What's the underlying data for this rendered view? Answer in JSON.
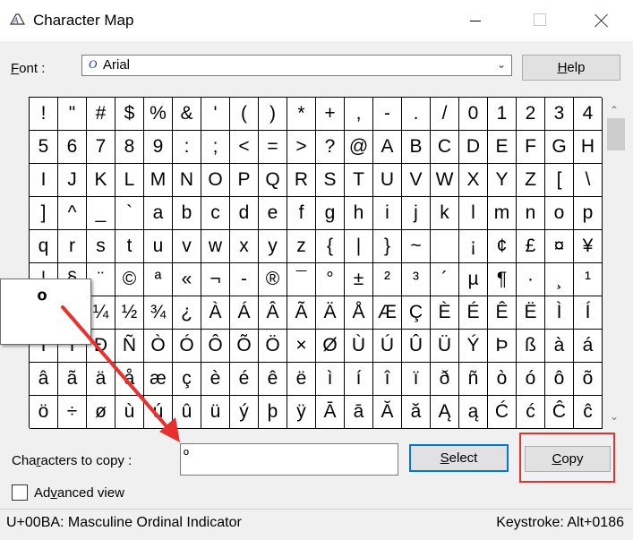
{
  "window": {
    "title": "Character Map",
    "app_icon": "character-map-icon"
  },
  "font": {
    "label_prefix": "F",
    "label_rest": "ont :",
    "selected": "Arial",
    "font_icon": "opentype-font-icon"
  },
  "help_button": {
    "label_underlined": "H",
    "label_rest": "elp"
  },
  "characters": [
    "!",
    "\"",
    "#",
    "$",
    "%",
    "&",
    "'",
    "(",
    ")",
    "*",
    "+",
    ",",
    "-",
    ".",
    "/",
    "0",
    "1",
    "2",
    "3",
    "4",
    "5",
    "6",
    "7",
    "8",
    "9",
    ":",
    ";",
    "<",
    "=",
    ">",
    "?",
    "@",
    "A",
    "B",
    "C",
    "D",
    "E",
    "F",
    "G",
    "H",
    "I",
    "J",
    "K",
    "L",
    "M",
    "N",
    "O",
    "P",
    "Q",
    "R",
    "S",
    "T",
    "U",
    "V",
    "W",
    "X",
    "Y",
    "Z",
    "[",
    "\\",
    "]",
    "^",
    "_",
    "`",
    "a",
    "b",
    "c",
    "d",
    "e",
    "f",
    "g",
    "h",
    "i",
    "j",
    "k",
    "l",
    "m",
    "n",
    "o",
    "p",
    "q",
    "r",
    "s",
    "t",
    "u",
    "v",
    "w",
    "x",
    "y",
    "z",
    "{",
    "|",
    "}",
    "~",
    " ",
    "¡",
    "¢",
    "£",
    "¤",
    "¥",
    "¦",
    "§",
    "¨",
    "©",
    "ª",
    "«",
    "¬",
    "-",
    "®",
    "¯",
    "°",
    "±",
    "²",
    "³",
    "´",
    "µ",
    "¶",
    "·",
    "¸",
    "¹",
    "º",
    "»",
    "¼",
    "½",
    "¾",
    "¿",
    "À",
    "Á",
    "Â",
    "Ã",
    "Ä",
    "Å",
    "Æ",
    "Ç",
    "È",
    "É",
    "Ê",
    "Ë",
    "Ì",
    "Í",
    "Î",
    "Ï",
    "Ð",
    "Ñ",
    "Ò",
    "Ó",
    "Ô",
    "Õ",
    "Ö",
    "×",
    "Ø",
    "Ù",
    "Ú",
    "Û",
    "Ü",
    "Ý",
    "Þ",
    "ß",
    "à",
    "á",
    "â",
    "ã",
    "ä",
    "å",
    "æ",
    "ç",
    "è",
    "é",
    "ê",
    "ë",
    "ì",
    "í",
    "î",
    "ï",
    "ð",
    "ñ",
    "ò",
    "ó",
    "ô",
    "õ",
    "ö",
    "÷",
    "ø",
    "ù",
    "ú",
    "û",
    "ü",
    "ý",
    "þ",
    "ÿ",
    "Ā",
    "ā",
    "Ă",
    "ă",
    "Ą",
    "ą",
    "Ć",
    "ć",
    "Ĉ",
    "ĉ"
  ],
  "zoom": {
    "character": "º"
  },
  "copy": {
    "label_prefix": "Cha",
    "label_underlined": "r",
    "label_rest": "acters to copy :",
    "value": "º"
  },
  "select_button": {
    "label_underlined": "S",
    "label_rest": "elect"
  },
  "copy_button": {
    "label_underlined": "C",
    "label_rest": "opy"
  },
  "advanced": {
    "label_prefix": "Ad",
    "label_underlined": "v",
    "label_rest": "anced view",
    "checked": false
  },
  "status": {
    "char_info": "U+00BA: Masculine Ordinal Indicator",
    "keystroke": "Keystroke: Alt+0186"
  },
  "annotation_color": "#e8312f",
  "scrollbar": {
    "up_icon": "scroll-up-arrow-icon",
    "down_icon": "scroll-down-arrow-icon"
  }
}
